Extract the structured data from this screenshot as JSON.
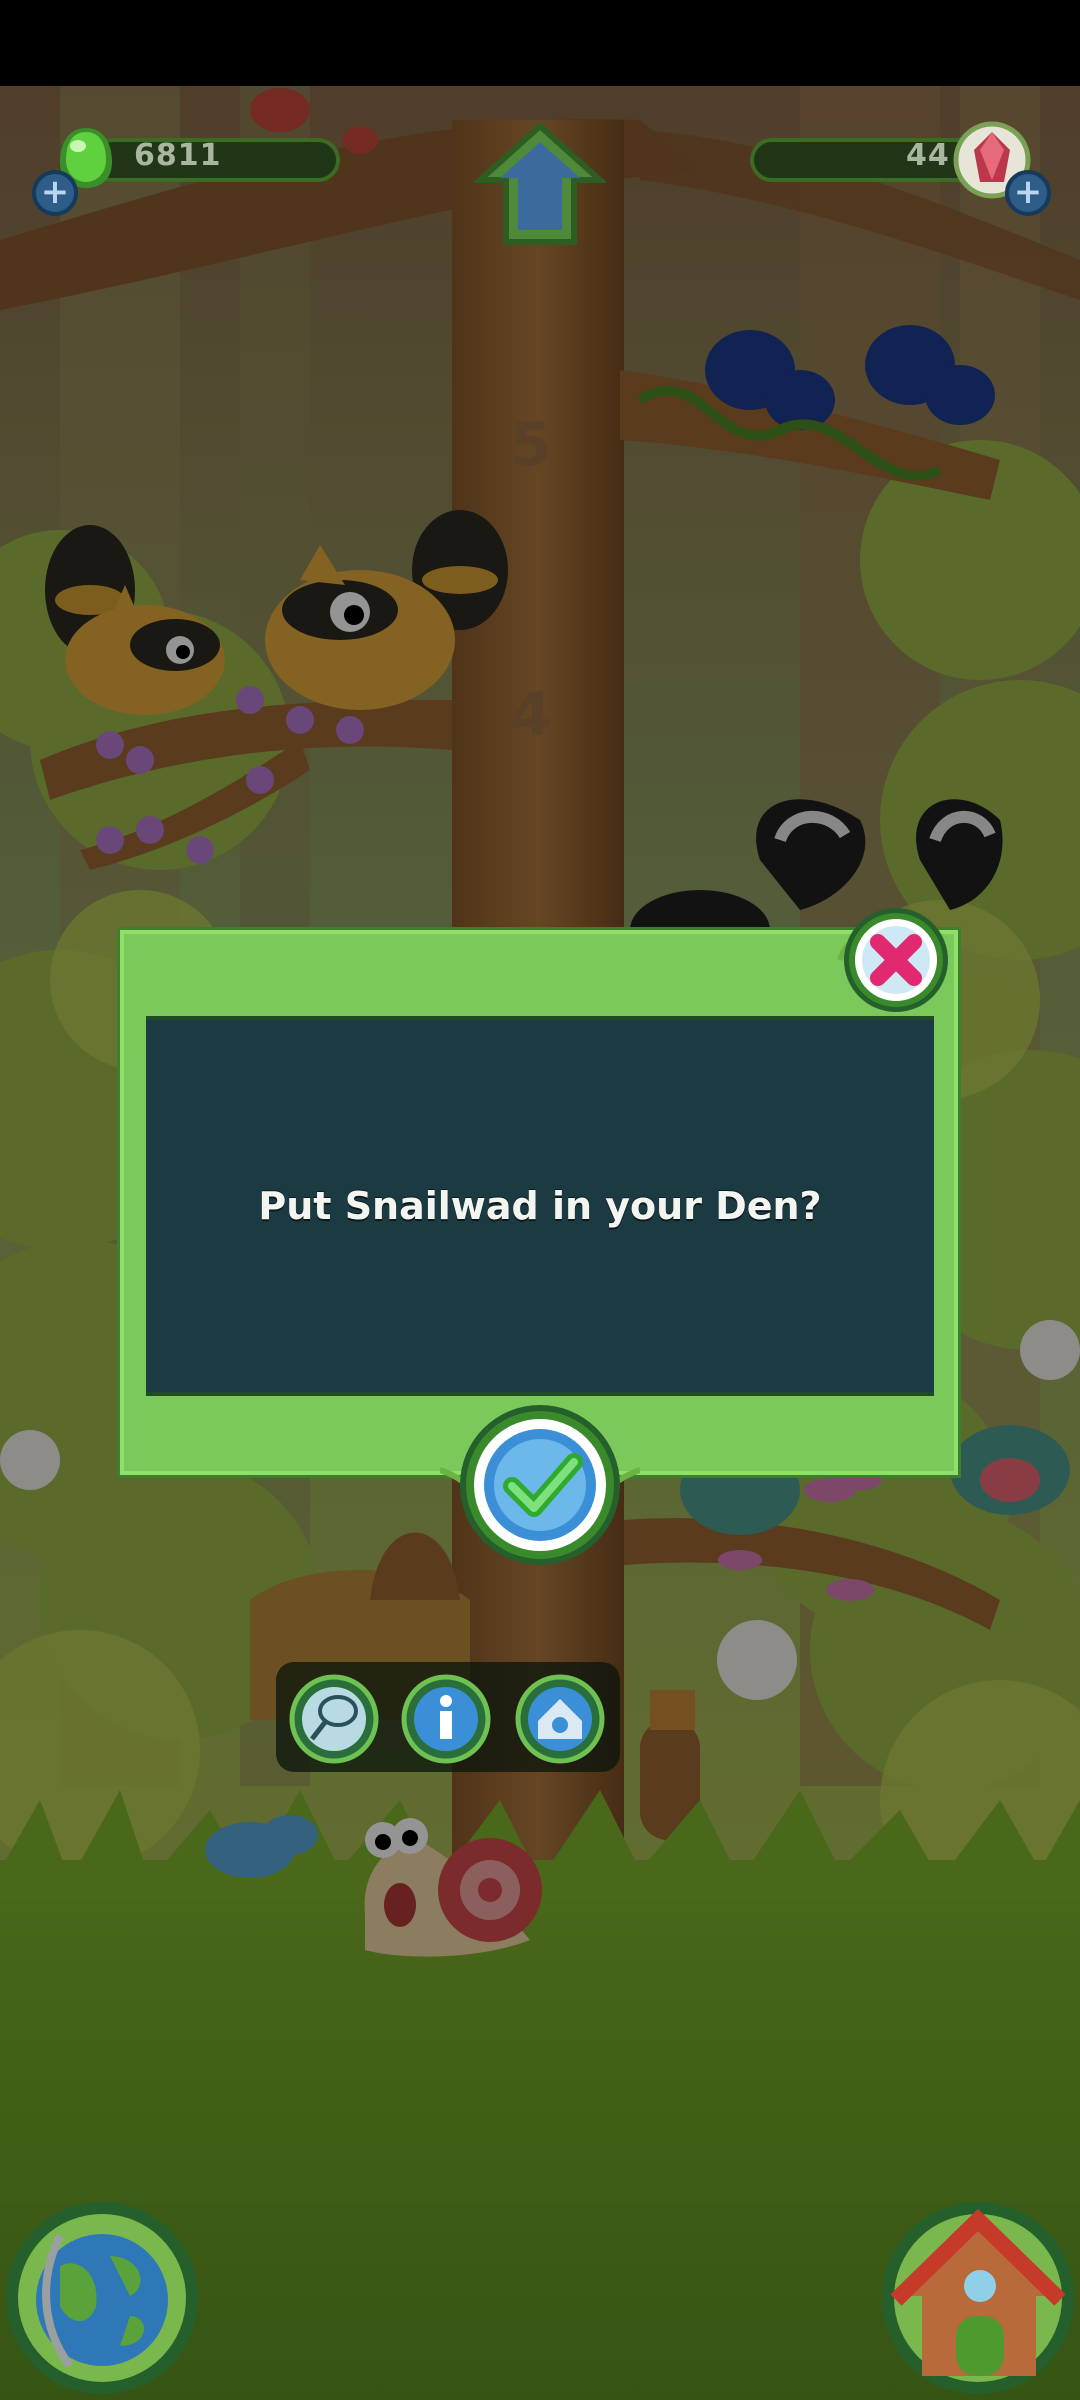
{
  "hud": {
    "gel_count": "6811",
    "gem_count": "44",
    "gel_icon": "green-gel-icon",
    "gem_icon": "red-gem-icon",
    "plus_icon": "plus-icon",
    "home_icon": "home-arrow-icon"
  },
  "tree_markers": [
    "5",
    "4"
  ],
  "dialog": {
    "message": "Put Snailwad in your Den?",
    "close_icon": "close-x-icon",
    "confirm_icon": "checkmark-icon"
  },
  "actions": [
    {
      "name": "net",
      "icon": "net-icon"
    },
    {
      "name": "info",
      "icon": "info-icon"
    },
    {
      "name": "den",
      "icon": "den-icon"
    }
  ],
  "bottom": {
    "left_icon": "globe-icon",
    "right_icon": "den-house-icon"
  },
  "colors": {
    "dialog_green": "#7bc95a",
    "dialog_panel": "#1c3a42",
    "hud_green": "#3c6b22",
    "plus_blue": "#2f5d89",
    "close_pink": "#e0296f",
    "check_blue": "#3a8fd6"
  }
}
